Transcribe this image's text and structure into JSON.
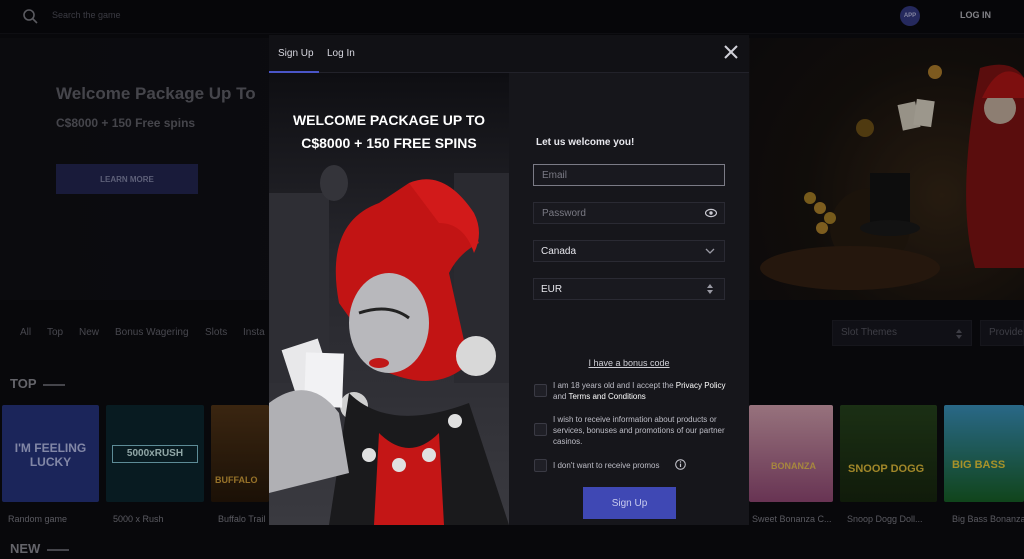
{
  "header": {
    "search_placeholder": "Search the game",
    "app_badge": "APP",
    "login_label": "LOG IN"
  },
  "hero": {
    "title": "Welcome Package Up To",
    "subtitle": "C$8000 + 150 Free spins",
    "cta_label": "LEARN MORE"
  },
  "filters": {
    "items": [
      "All",
      "Top",
      "New",
      "Bonus Wagering",
      "Slots",
      "Insta"
    ],
    "theme_dropdown": "Slot Themes",
    "provider_dropdown": "Provide"
  },
  "sections": {
    "top_title": "TOP",
    "new_title": "NEW"
  },
  "games": [
    {
      "title": "Random game",
      "art_text": "I'M FEELING LUCKY"
    },
    {
      "title": "5000 x Rush",
      "art_text": "5000xRUSH"
    },
    {
      "title": "Buffalo Trail",
      "art_text": "BUFFALO"
    },
    {
      "title": "Sweet Bonanza C...",
      "art_text": "BONANZA"
    },
    {
      "title": "Snoop Dogg Doll...",
      "art_text": "SNOOP DOGG"
    },
    {
      "title": "Big Bass Bonanza",
      "art_text": "BIG BASS"
    }
  ],
  "modal": {
    "tabs": [
      "Sign Up",
      "Log In"
    ],
    "active_tab": "Sign Up",
    "promo_line1": "WELCOME PACKAGE UP TO",
    "promo_line2": "C$8000 + 150 FREE SPINS",
    "form_title": "Let us welcome you!",
    "email_placeholder": "Email",
    "password_placeholder": "Password",
    "country_value": "Canada",
    "currency_value": "EUR",
    "bonus_code_link": "I have a bonus code",
    "consent_age_prefix": "I am 18 years old and I accept the ",
    "consent_age_privacy": "Privacy Policy",
    "consent_age_and": " and ",
    "consent_age_terms": "Terms and Conditions",
    "consent_marketing": "I wish to receive information about products or services, bonuses and promotions of our partner casinos.",
    "consent_no_promos": "I don't want to receive promos",
    "submit_label": "Sign Up"
  },
  "colors": {
    "accent": "#3f48b4",
    "modal_bg": "#141419",
    "page_bg": "#0d0d12"
  }
}
